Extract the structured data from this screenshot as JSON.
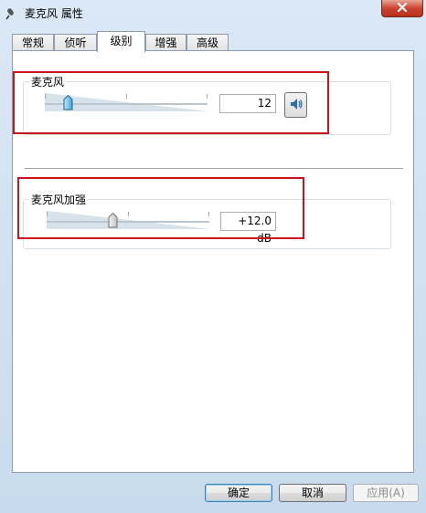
{
  "window": {
    "title": "麦克风 属性"
  },
  "tabs": [
    {
      "label": "常规",
      "active": false
    },
    {
      "label": "侦听",
      "active": false
    },
    {
      "label": "级别",
      "active": true
    },
    {
      "label": "增强",
      "active": false
    },
    {
      "label": "高级",
      "active": false
    }
  ],
  "microphone": {
    "label": "麦克风",
    "value": "12",
    "level_fraction": 0.12
  },
  "boost": {
    "label": "麦克风加强",
    "value": "+12.0 dB",
    "level_fraction": 0.4
  },
  "buttons": {
    "ok": "确定",
    "cancel": "取消",
    "apply": "应用(A)"
  },
  "colors": {
    "highlight": "#c9141b",
    "accent": "#3c7fb1"
  },
  "icons": {
    "title": "microphone-icon",
    "speaker": "speaker-icon",
    "close": "close-icon"
  }
}
